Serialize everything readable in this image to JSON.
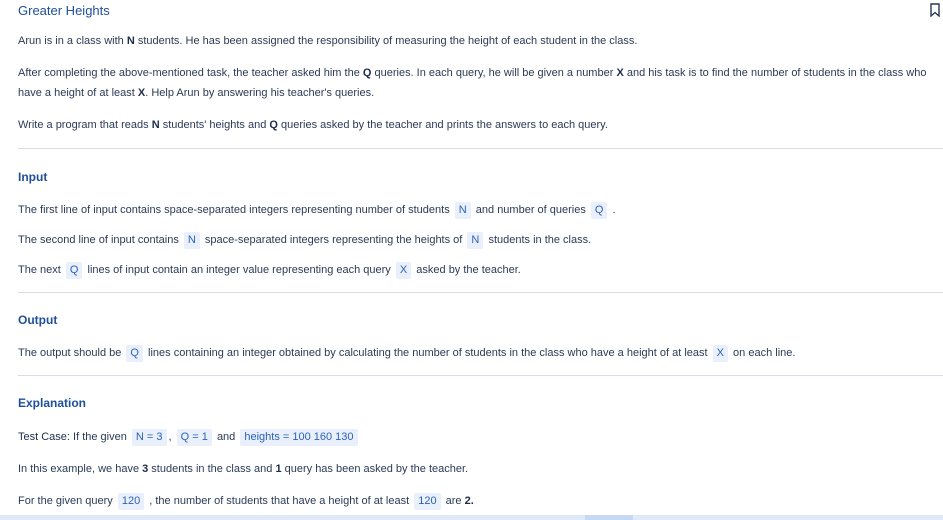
{
  "title": "Greater Heights",
  "intro": {
    "p1_a": "Arun is in a class with ",
    "p1_n": "N",
    "p1_b": " students. He has been assigned the responsibility of measuring the height of each student in the class.",
    "p2_a": "After completing the above-mentioned task, the teacher asked him the ",
    "p2_q": "Q",
    "p2_b": " queries. In each query, he will be given a number ",
    "p2_x": "X",
    "p2_c": " and his task is to find the number of students in the class who have a height of at least ",
    "p2_x2": "X",
    "p2_d": ". Help Arun by answering his teacher's queries.",
    "p3_a": "Write a program that reads ",
    "p3_n": "N",
    "p3_b": " students' heights and ",
    "p3_q": "Q",
    "p3_c": " queries asked by the teacher and prints the answers to each query."
  },
  "input": {
    "heading": "Input",
    "l1_a": "The first line of input contains space-separated integers representing number of students",
    "l1_n": "N",
    "l1_b": "and number of queries",
    "l1_q": "Q",
    "l1_c": ".",
    "l2_a": "The second line of input contains",
    "l2_n": "N",
    "l2_b": "space-separated integers representing the heights of",
    "l2_n2": "N",
    "l2_c": "students in the class.",
    "l3_a": "The next",
    "l3_q": "Q",
    "l3_b": "lines of input contain an integer value representing each query",
    "l3_x": "X",
    "l3_c": "asked by the teacher."
  },
  "output": {
    "heading": "Output",
    "l1_a": "The output should be",
    "l1_q": "Q",
    "l1_b": "lines containing an integer obtained by calculating the number of students in the class who have a height of at least",
    "l1_x": "X",
    "l1_c": "on each line."
  },
  "explanation": {
    "heading": "Explanation",
    "tc_a": "Test Case:",
    "tc_b": "If the given",
    "tc_n": "N = 3",
    "tc_comma": ",",
    "tc_q": "Q = 1",
    "tc_and": "and",
    "tc_h": "heights = 100 160 130",
    "e1_a": "In this example, we have ",
    "e1_n": "3",
    "e1_b": " students in the class and ",
    "e1_q": "1",
    "e1_c": " query has been asked by the teacher.",
    "e2_a": "For the given query",
    "e2_v": "120",
    "e2_b": ", the number of students that have a height of at least",
    "e2_v2": "120",
    "e2_c": "are ",
    "e2_ans": "2."
  },
  "colors": {
    "accent": "#1f4f99",
    "code_bg": "#e9f0fb",
    "code_text": "#2b62b8",
    "body_text": "#2b3a55"
  },
  "icons": {
    "bookmark": "bookmark-icon"
  }
}
